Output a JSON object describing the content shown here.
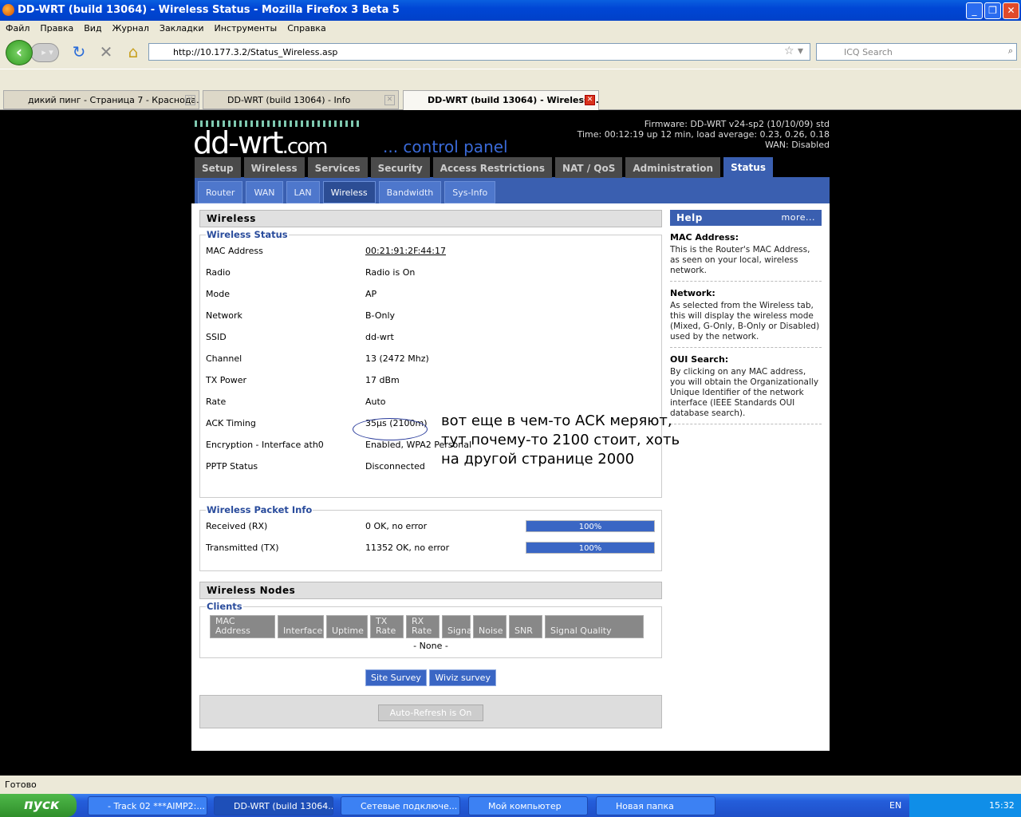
{
  "window": {
    "title": "DD-WRT (build 13064) - Wireless Status - Mozilla Firefox 3 Beta 5"
  },
  "menu": [
    "Файл",
    "Правка",
    "Вид",
    "Журнал",
    "Закладки",
    "Инструменты",
    "Справка"
  ],
  "url": "http://10.177.3.2/Status_Wireless.asp",
  "search_placeholder": "ICQ Search",
  "tabs": [
    "дикий пинг - Страница 7 - Краснода...",
    "DD-WRT (build 13064) - Info",
    "DD-WRT (build 13064) - Wireless ..."
  ],
  "status_text": "Готово",
  "header": {
    "logo": "dd-wrt",
    "logo_suffix": ".com",
    "tagline": "... control panel",
    "firmware": "Firmware: DD-WRT v24-sp2 (10/10/09) std",
    "time": "Time: 00:12:19 up 12 min, load average: 0.23, 0.26, 0.18",
    "wan": "WAN: Disabled"
  },
  "main_tabs": [
    "Setup",
    "Wireless",
    "Services",
    "Security",
    "Access Restrictions",
    "NAT / QoS",
    "Administration",
    "Status"
  ],
  "sub_tabs": [
    "Router",
    "WAN",
    "LAN",
    "Wireless",
    "Bandwidth",
    "Sys-Info"
  ],
  "wireless": {
    "title": "Wireless",
    "status_legend": "Wireless Status",
    "rows": [
      [
        "MAC Address",
        "00:21:91:2F:44:17"
      ],
      [
        "Radio",
        "Radio is On"
      ],
      [
        "Mode",
        "AP"
      ],
      [
        "Network",
        "B-Only"
      ],
      [
        "SSID",
        "dd-wrt"
      ],
      [
        "Channel",
        "13 (2472 Mhz)"
      ],
      [
        "TX Power",
        "17 dBm"
      ],
      [
        "Rate",
        "Auto"
      ],
      [
        "ACK Timing",
        "35µs (2100m)"
      ],
      [
        "Encryption - Interface ath0",
        "Enabled, WPA2 Personal"
      ],
      [
        "PPTP Status",
        "Disconnected"
      ]
    ]
  },
  "packet": {
    "legend": "Wireless Packet Info",
    "rows": [
      {
        "label": "Received (RX)",
        "value": "0 OK, no error",
        "bar": "100%",
        "percent": 100
      },
      {
        "label": "Transmitted (TX)",
        "value": "11352 OK, no error",
        "bar": "100%",
        "percent": 100
      }
    ]
  },
  "nodes": {
    "title": "Wireless Nodes",
    "legend": "Clients",
    "columns": [
      "MAC Address",
      "Interface",
      "Uptime",
      "TX Rate",
      "RX Rate",
      "Signal",
      "Noise",
      "SNR",
      "Signal Quality"
    ],
    "empty": "- None -"
  },
  "buttons": {
    "site_survey": "Site Survey",
    "wiviz": "Wiviz survey",
    "auto_refresh": "Auto-Refresh is On"
  },
  "help": {
    "title": "Help",
    "more": "more...",
    "sections": [
      {
        "title": "MAC Address:",
        "text": "This is the Router's MAC Address, as seen on your local, wireless network."
      },
      {
        "title": "Network:",
        "text": "As selected from the Wireless tab, this will display the wireless mode (Mixed, G-Only, B-Only or Disabled) used by the network."
      },
      {
        "title": "OUI Search:",
        "text": "By clicking on any MAC address, you will obtain the Organizationally Unique Identifier of the network interface (IEEE Standards OUI database search)."
      }
    ]
  },
  "annotation": "вот еще в чем-то АСК меряют, тут почему-то 2100 стоит, хоть на другой странице 2000",
  "taskbar": {
    "start": "пуск",
    "items": [
      "- Track 02 ***AIMP2:...",
      "DD-WRT (build 13064...",
      "Сетевые подключе...",
      "Мой компьютер",
      "Новая папка"
    ],
    "lang": "EN",
    "clock": "15:32"
  }
}
